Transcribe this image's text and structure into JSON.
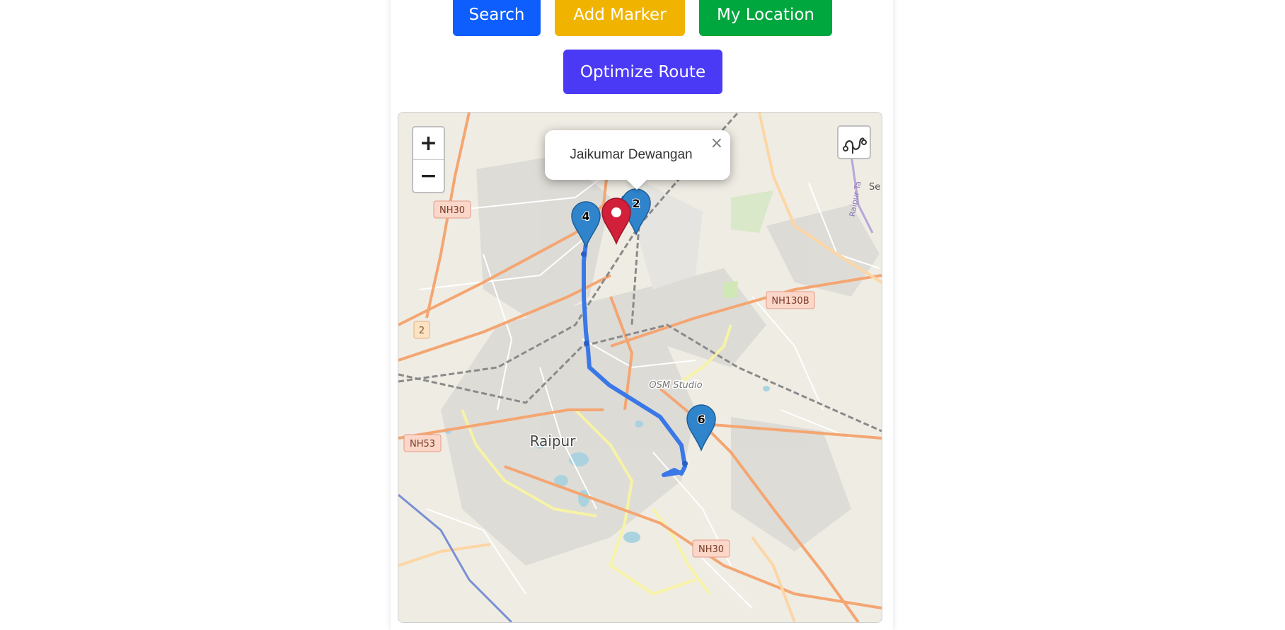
{
  "toolbar": {
    "search_label": "Search",
    "add_marker_label": "Add Marker",
    "my_location_label": "My Location",
    "optimize_route_label": "Optimize Route"
  },
  "colors": {
    "search": "#0d5efd",
    "add_marker": "#f0b400",
    "my_location": "#00a63e",
    "optimize_route": "#4b3af5",
    "route_line": "#3b78e7",
    "marker_blue": "#2f84cc",
    "marker_red": "#d3203a"
  },
  "map": {
    "zoom_in": "+",
    "zoom_out": "−",
    "popup": {
      "text": "Jaikumar Dewangan",
      "close": "×"
    },
    "route_control_icon": "route-icon",
    "city_label": "Raipur",
    "labels": {
      "nh30_top": "NH30",
      "nh130b": "NH130B",
      "road_2": "2",
      "nh53": "NH53",
      "nh30_bottom": "NH30",
      "osm_studio": "OSM Studio",
      "se": "Se",
      "raipur_tank": "Raipur Ta"
    },
    "markers": [
      {
        "label": "4",
        "color": "blue"
      },
      {
        "label": "",
        "color": "red"
      },
      {
        "label": "2",
        "color": "blue"
      },
      {
        "label": "6",
        "color": "blue"
      }
    ]
  }
}
